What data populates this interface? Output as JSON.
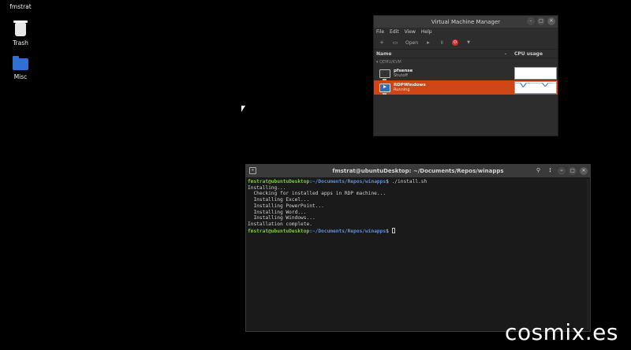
{
  "desktop": {
    "icons": [
      {
        "label": "fmstrat",
        "icon": "folder-icon"
      },
      {
        "label": "Trash",
        "icon": "trash-icon"
      },
      {
        "label": "Misc",
        "icon": "folder-icon"
      }
    ]
  },
  "vmm": {
    "title": "Virtual Machine Manager",
    "menu": [
      "File",
      "Edit",
      "View",
      "Help"
    ],
    "toolbar": {
      "open_label": "Open"
    },
    "columns": {
      "name": "Name",
      "cpu": "CPU usage"
    },
    "group": "QEMU/KVM",
    "vms": [
      {
        "name": "pfsense",
        "status": "Shutoff",
        "selected": false
      },
      {
        "name": "RDPWindows",
        "status": "Running",
        "selected": true
      }
    ],
    "cpu_history": [
      0.95,
      0.9,
      0.92,
      0.55,
      0.9,
      0.93,
      0.9,
      0.94,
      0.9,
      0.88,
      0.92,
      0.6,
      0.9,
      0.93,
      0.91,
      0.9
    ]
  },
  "terminal": {
    "title": "fmstrat@ubuntuDesktop: ~/Documents/Repos/winapps",
    "prompt_user": "fmstrat@ubuntuDesktop",
    "prompt_path": ":~/Documents/Repos/winapps",
    "command": "$ ./install.sh",
    "output": [
      "Installing...",
      "  Checking for installed apps in RDP machine...",
      "  Installing Excel...",
      "  Installing PowerPoint...",
      "  Installing Word...",
      "  Installing Windows...",
      "Installation complete."
    ],
    "prompt_end": "$ "
  },
  "watermark": "cosmix.es",
  "colors": {
    "selection": "#cf4516",
    "prompt_user": "#7ec943",
    "prompt_path": "#5f8fd6",
    "folder": "#2f6fd6"
  }
}
